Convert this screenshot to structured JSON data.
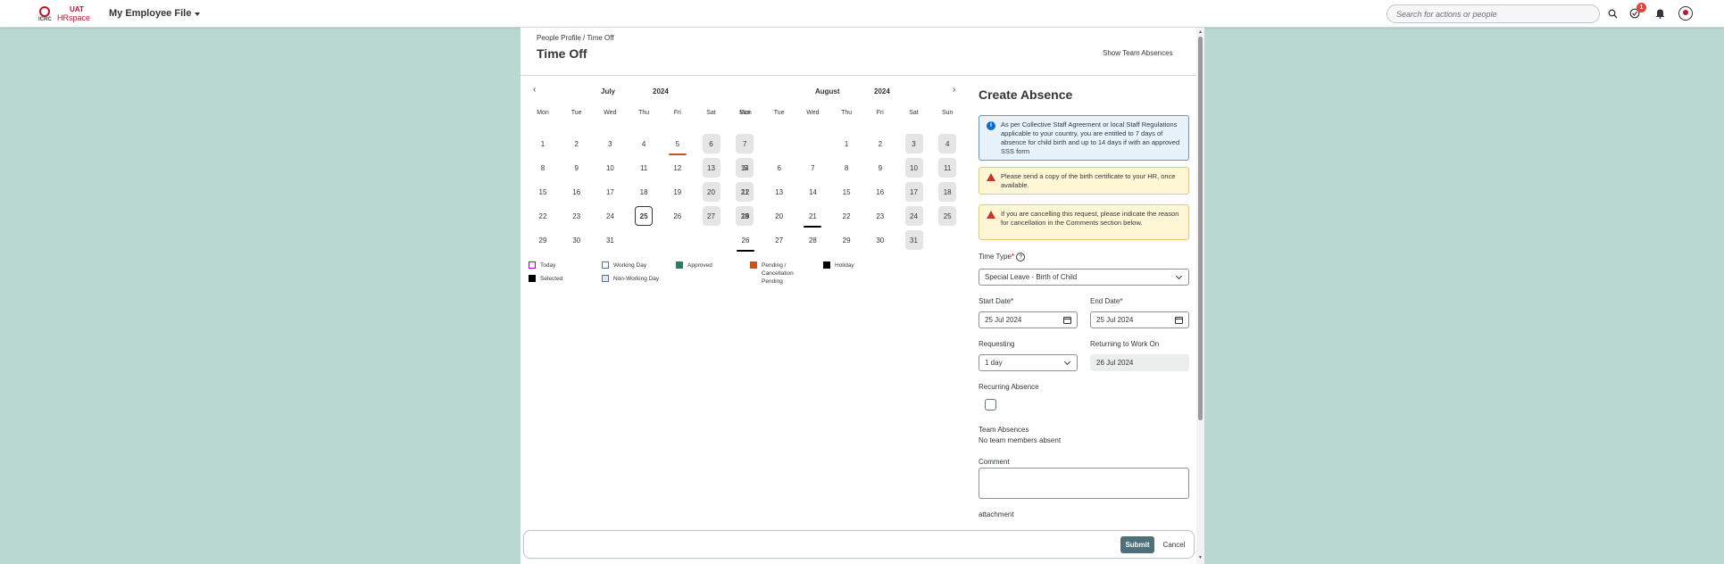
{
  "topbar": {
    "logo_small": "ICRC",
    "logo_env": "UAT",
    "logo_name": "HRspace",
    "app_title": "My Employee File",
    "search_placeholder": "Search for actions or people",
    "notification_count": "1"
  },
  "page": {
    "breadcrumb": "People Profile / Time Off",
    "title": "Time Off",
    "show_team": "Show Team Absences"
  },
  "calendar": {
    "months": [
      {
        "month": "July",
        "year": "2024"
      },
      {
        "month": "August",
        "year": "2024"
      }
    ],
    "dow": [
      "Mon",
      "Tue",
      "Wed",
      "Thu",
      "Fri",
      "Sat",
      "Sun"
    ],
    "july_days": [
      "1",
      "2",
      "3",
      "4",
      "5",
      "6",
      "7",
      "8",
      "9",
      "10",
      "11",
      "12",
      "13",
      "14",
      "15",
      "16",
      "17",
      "18",
      "19",
      "20",
      "21",
      "22",
      "23",
      "24",
      "25",
      "26",
      "27",
      "28",
      "29",
      "30",
      "31"
    ],
    "august_days": [
      "1",
      "2",
      "3",
      "4",
      "5",
      "6",
      "7",
      "8",
      "9",
      "10",
      "11",
      "12",
      "13",
      "14",
      "15",
      "16",
      "17",
      "18",
      "19",
      "20",
      "21",
      "22",
      "23",
      "24",
      "25",
      "26",
      "27",
      "28",
      "29",
      "30",
      "31"
    ],
    "today_july": "25",
    "colors": {
      "pending": "#c0571f",
      "holiday": "#000000",
      "approved": "#2f7a5b",
      "today": "#a100c2",
      "weekend": "#e5e5e5"
    },
    "legend": {
      "today": "Today",
      "working_day": "Working Day",
      "approved": "Approved",
      "pending_line1": "Pending /",
      "pending_line2": "Cancellation",
      "pending_line3": "Pending",
      "holiday": "Holiday",
      "selected": "Selected",
      "non_working_day": "Non-Working Day"
    }
  },
  "form": {
    "title": "Create Absence",
    "info_message": "As per Collective Staff Agreement or local Staff Regulations applicable to your country, you are entitled to 7 days of absence for child birth and up to 14 days if with an approved SSS form",
    "warning1": "Please send a copy of the birth certificate to your HR, once available.",
    "warning2": "If you are cancelling this request, please indicate the reason for cancellation in the Comments section below.",
    "time_type_label": "Time Type",
    "time_type_value": "Special Leave - Birth of Child",
    "start_date_label": "Start Date",
    "start_date_value": "25 Jul 2024",
    "end_date_label": "End Date",
    "end_date_value": "25 Jul 2024",
    "requesting_label": "Requesting",
    "requesting_value": "1 day",
    "returning_label": "Returning to Work On",
    "returning_value": "26 Jul 2024",
    "recurring_label": "Recurring Absence",
    "team_absences_label": "Team Absences",
    "team_absences_value": "No team members absent",
    "comment_label": "Comment",
    "attachment_label": "attachment"
  },
  "footer": {
    "submit": "Submit",
    "cancel": "Cancel"
  }
}
